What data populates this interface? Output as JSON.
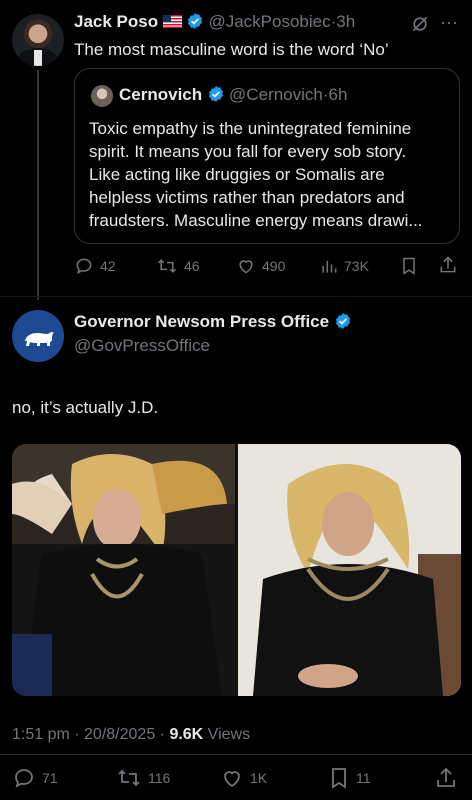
{
  "post1": {
    "author_name": "Jack Poso",
    "author_handle": "@JackPosobiec",
    "time": "3h",
    "text": "The most masculine word is the word ‘No’",
    "quote": {
      "author_name": "Cernovich",
      "author_handle": "@Cernovich",
      "time": "6h",
      "text_lines": [
        "Toxic empathy is the unintegrated feminine",
        "spirit. It means you fall for every sob story.",
        "Like acting like druggies or Somalis are",
        "helpless victims rather than predators and",
        "fraudsters. Masculine energy means drawi..."
      ]
    },
    "actions": {
      "replies": "42",
      "reposts": "46",
      "likes": "490",
      "views": "73K"
    }
  },
  "post2": {
    "author_name": "Governor Newsom Press Office",
    "author_handle": "@GovPressOffice",
    "text": "no, it’s actually J.D.",
    "timestamp": "1:51 pm · 20/8/2025 · ",
    "views_count": "9.6K",
    "views_label": " Views",
    "actions": {
      "replies": "71",
      "reposts": "116",
      "likes": "1K",
      "bookmarks": "11"
    }
  },
  "colors": {
    "background": "#000000",
    "text": "#e7e9ea",
    "muted": "#71767b",
    "verified": "#1d9bf0",
    "divider": "#2f3336"
  }
}
